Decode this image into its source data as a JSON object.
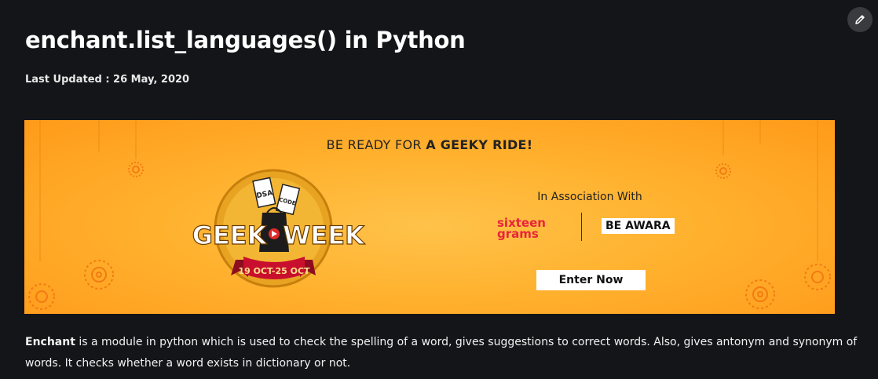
{
  "article": {
    "title": "enchant.list_languages() in Python",
    "last_updated": "Last Updated : 26 May, 2020",
    "intro_bold": "Enchant",
    "intro_rest": " is a module in python which is used to check the spelling of a word, gives suggestions to correct words. Also, gives antonym and synonym of words. It checks whether a word exists in dictionary or not."
  },
  "toolbar": {
    "edit_icon": "pencil-icon"
  },
  "banner": {
    "tagline_regular": "BE READY FOR ",
    "tagline_bold": "A GEEKY RIDE!",
    "association": "In Association With",
    "partner_1_line1": "sixteen",
    "partner_1_line2": "grams",
    "partner_2": "BE AWARA",
    "cta_label": "Enter Now",
    "logo_word_left": "GEEK",
    "logo_word_right": "WEEK",
    "logo_dates": "19 OCT-25 OCT",
    "ticket_1": "DSA",
    "ticket_2": "CODE",
    "colors": {
      "background": "#ffb22f",
      "logo_red": "#c8102e",
      "partner_red": "#e8243c"
    }
  },
  "colors": {
    "page_background": "#141519",
    "text": "#ffffff"
  }
}
